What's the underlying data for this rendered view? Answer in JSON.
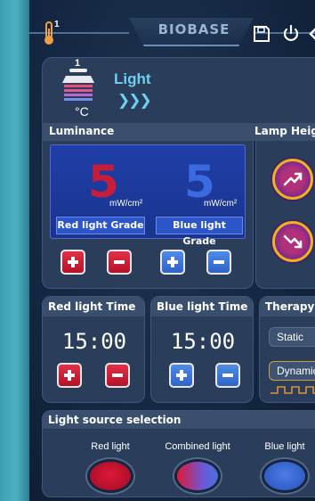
{
  "brand": "BIOBASE",
  "header": {
    "mode_label": "Light",
    "arrows": "❯❯❯",
    "temp_unit": "°C",
    "thermo_index": "1",
    "light_index": "1"
  },
  "sections": {
    "luminance": "Luminance",
    "lamp_height": "Lamp Heig"
  },
  "luminance": {
    "red_value": "5",
    "blue_value": "5",
    "unit": "mW/cm²",
    "red_grade": "Red light Grade",
    "blue_grade": "Blue light Grade"
  },
  "red_time": {
    "title": "Red light Time",
    "value": "15:00"
  },
  "blue_time": {
    "title": "Blue light Time",
    "value": "15:00"
  },
  "therapy": {
    "title": "Therapy",
    "options": [
      "Static",
      "Dynamic"
    ]
  },
  "source": {
    "title": "Light source selection",
    "options": [
      "Red light",
      "Combined light",
      "Blue light"
    ]
  },
  "icons": [
    "thermometer-icon",
    "save-icon",
    "power-icon",
    "back-icon",
    "light-lamp-icon",
    "lamp-up-icon",
    "lamp-down-icon"
  ],
  "colors": {
    "red": "#c71c3a",
    "blue": "#3a6ae0",
    "accent_cyan": "#6ed0ee",
    "panel": "#2a3e5c",
    "lamp_ring": "#f0b020"
  }
}
